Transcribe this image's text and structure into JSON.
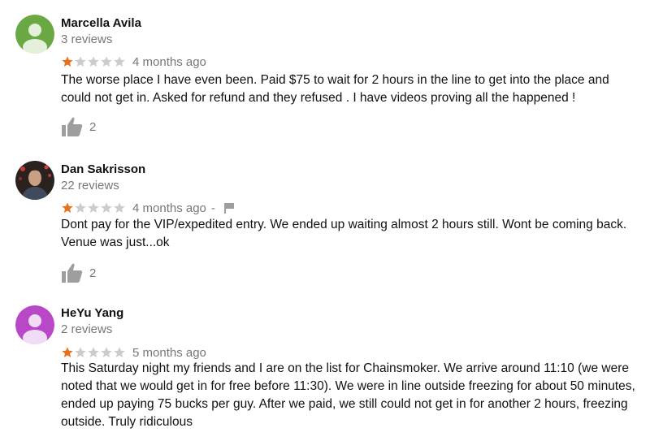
{
  "reviews": [
    {
      "name": "Marcella Avila",
      "review_count": "3 reviews",
      "rating": 1,
      "max_rating": 5,
      "date": "4 months ago",
      "has_flag": false,
      "text": "The worse place I have even been. Paid $75 to wait for 2 hours in the line to get into the place and could not get in. Asked for refund and they refused . I have videos proving all the happened !",
      "likes": "2",
      "avatar": {
        "type": "default",
        "color": "#6aa844",
        "icon": "person-icon"
      }
    },
    {
      "name": "Dan Sakrisson",
      "review_count": "22 reviews",
      "rating": 1,
      "max_rating": 5,
      "date": "4 months ago",
      "separator": "-",
      "has_flag": true,
      "text": "Dont pay for the VIP/expedited entry. We ended up waiting almost 2 hours still. Wont be coming back. Venue was just...ok",
      "likes": "2",
      "avatar": {
        "type": "photo",
        "icon": "profile-photo"
      }
    },
    {
      "name": "HeYu Yang",
      "review_count": "2 reviews",
      "rating": 1,
      "max_rating": 5,
      "date": "5 months ago",
      "has_flag": false,
      "text": "This Saturday night my friends and I are on the list for Chainsmoker. We arrive around 11:10 (we were noted that we would get in for free before 11:30). We were in line outside freezing for about 50 minutes, ended up paying 75 bucks per guy. After we paid, we still could not get in for another 2 hours, freezing outside. Truly ridiculous",
      "avatar": {
        "type": "default",
        "color": "#b848c8",
        "icon": "person-icon"
      }
    }
  ],
  "colors": {
    "star_filled": "#e8711e",
    "star_empty": "#cccccc",
    "muted_text": "#777777",
    "icon_gray": "#9e9e9e"
  }
}
